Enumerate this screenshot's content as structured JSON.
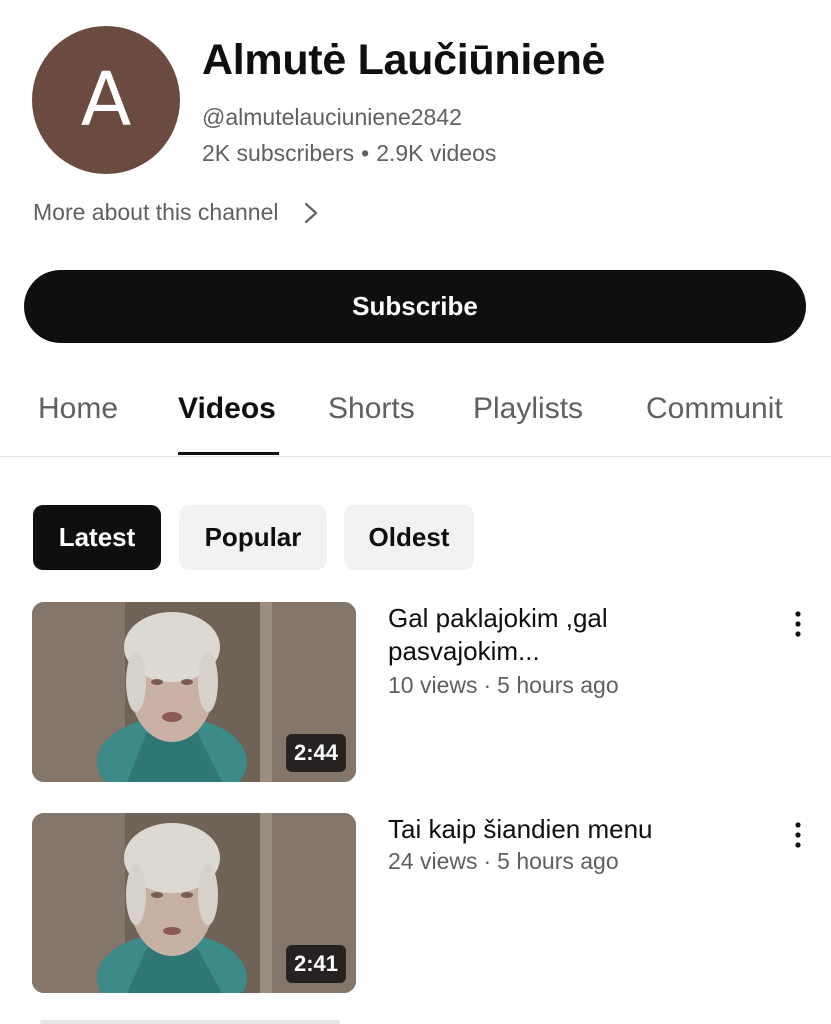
{
  "channel": {
    "avatar_letter": "A",
    "avatar_color": "#6b4a3f",
    "name": "Almutė Laučiūnienė",
    "handle": "@almutelauciuniene2842",
    "subscribers": "2K subscribers",
    "separator": "•",
    "videos": "2.9K videos",
    "more_about": "More about this channel",
    "more_icon": "chevron-right-icon"
  },
  "subscribe": {
    "label": "Subscribe"
  },
  "tabs": [
    {
      "label": "Home",
      "active": false
    },
    {
      "label": "Videos",
      "active": true
    },
    {
      "label": "Shorts",
      "active": false
    },
    {
      "label": "Playlists",
      "active": false
    },
    {
      "label": "Communit",
      "active": false
    }
  ],
  "filters": [
    {
      "label": "Latest",
      "active": true
    },
    {
      "label": "Popular",
      "active": false
    },
    {
      "label": "Oldest",
      "active": false
    }
  ],
  "videos": [
    {
      "title": "Gal paklajokim ,gal pasvajokim...",
      "views": "10 views",
      "sep": "·",
      "age": "5 hours ago",
      "duration": "2:44",
      "menu_icon": "more-vertical-icon"
    },
    {
      "title": "Tai kaip šiandien menu",
      "views": "24 views",
      "sep": "·",
      "age": "5 hours ago",
      "duration": "2:41",
      "menu_icon": "more-vertical-icon"
    }
  ],
  "colors": {
    "accent": "#0f0f0f",
    "secondary_text": "#606060",
    "chip_bg": "#f2f2f2"
  }
}
